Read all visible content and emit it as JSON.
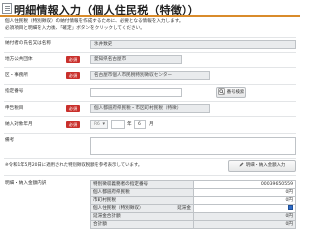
{
  "header": {
    "title": "明細情報入力（個人住民税（特徴））"
  },
  "intro": {
    "line1": "個人住民税（特別徴収）の納付情報を作成するために、必要となる情報を入力します。",
    "line2": "必須項目と明細を入力後、「確定」ボタンをクリックしてください。"
  },
  "required_badge": "必須",
  "form": {
    "payer_name": {
      "label": "納付者の氏名又は名称",
      "value": "氷井数史"
    },
    "municipality": {
      "label": "地方公共団体",
      "value": "愛知県名古屋市"
    },
    "district": {
      "label": "区・事務所",
      "value": "名古屋市個人市民税特別徴収センター"
    },
    "designation_no": {
      "label": "指定番号",
      "value": "",
      "button": "番号検索"
    },
    "submitter": {
      "label": "申告税目",
      "value": "個人都道府県民税・市区町村民税（特徴）"
    },
    "payment_period": {
      "label": "納入対象年月",
      "era": "R6",
      "year": "",
      "year_unit": "年",
      "month": "6",
      "month_unit": "月"
    },
    "remarks": {
      "label": "備考",
      "value": ""
    }
  },
  "note": "※令和1年5月20日に適用された特別徴収税額を参考表示しています。",
  "breakdown_button": "明細・納入金額入力",
  "breakdown": {
    "label": "明細・納入金額内訳",
    "rows": [
      {
        "key": "特別徴収義務者の指定番号",
        "value": "00039650559"
      },
      {
        "key": "個人都道府県民税",
        "value": "0円"
      },
      {
        "key": "市町村民税",
        "value": "0円"
      },
      {
        "key": "個人住民税（特別徴収）",
        "key2": "延滞金",
        "value": ""
      },
      {
        "key": "延滞金合計額",
        "value": "0円"
      },
      {
        "key": "合計額",
        "value": "0円"
      }
    ]
  },
  "colors": {
    "accent": "#d98b2b",
    "required": "#c9302c",
    "checkbox": "#2d6bc9"
  }
}
